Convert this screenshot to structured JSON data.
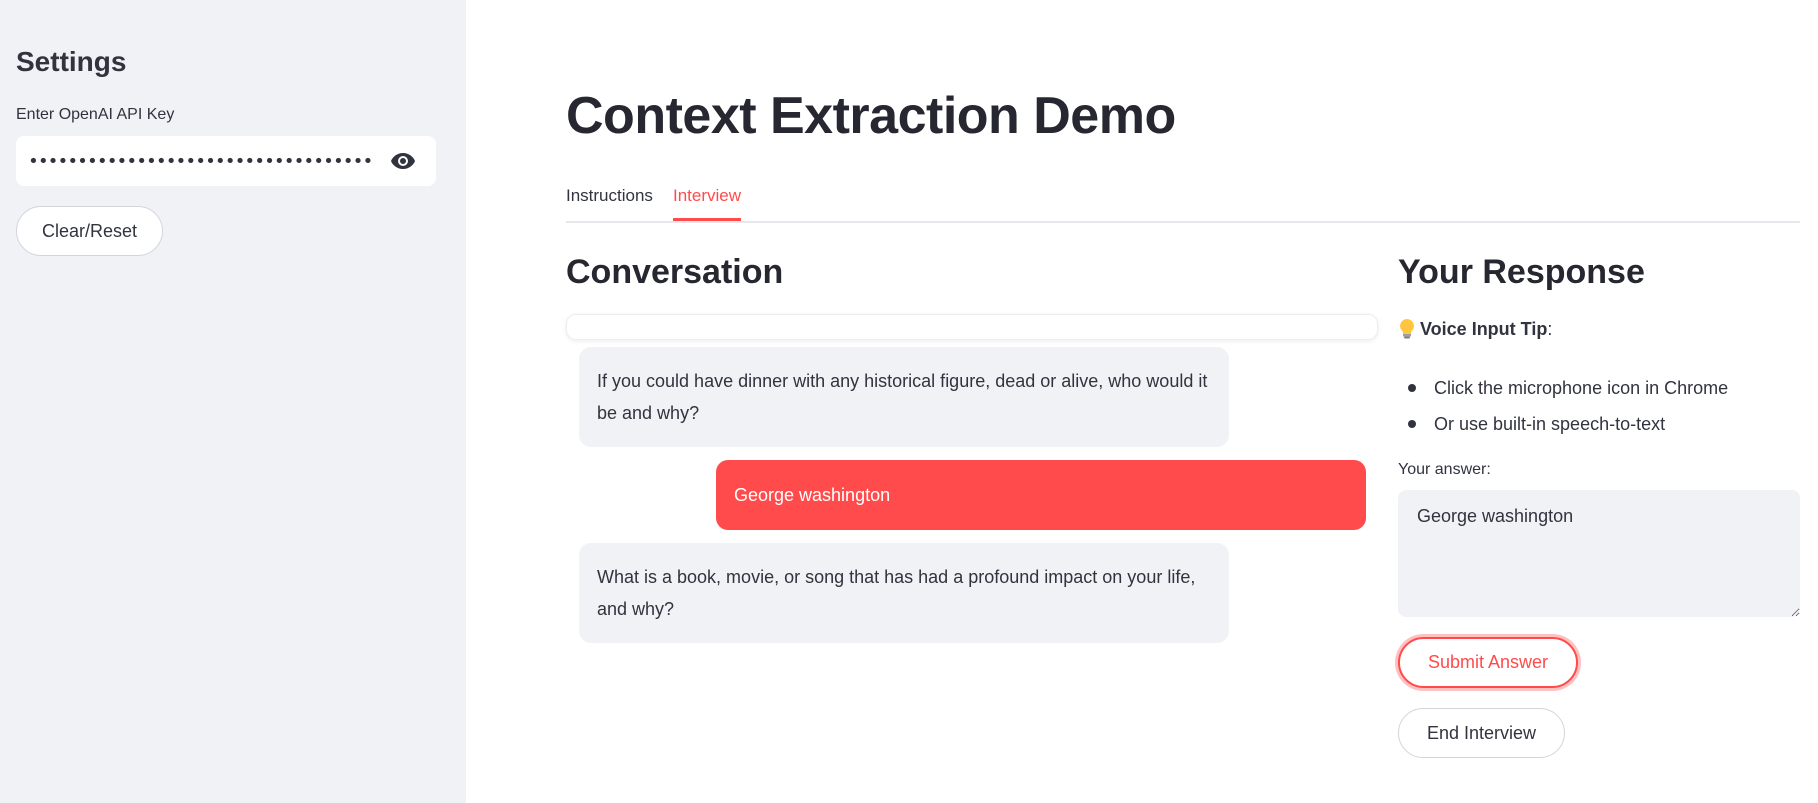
{
  "sidebar": {
    "title": "Settings",
    "api_key_label": "Enter OpenAI API Key",
    "api_key_value": "•••••••••••••••••••••••••••••••••••••••••••••••••••",
    "show_password_icon": "eye-icon",
    "clear_reset_label": "Clear/Reset"
  },
  "main": {
    "title": "Context Extraction Demo",
    "tabs": [
      {
        "label": "Instructions",
        "active": false
      },
      {
        "label": "Interview",
        "active": true
      }
    ],
    "conversation": {
      "title": "Conversation",
      "messages": [
        {
          "role": "assistant",
          "text": "If you could have dinner with any historical figure, dead or alive, who would it be and why?"
        },
        {
          "role": "user",
          "text": "George washington"
        },
        {
          "role": "assistant",
          "text": "What is a book, movie, or song that has had a profound impact on your life, and why?"
        }
      ]
    },
    "response": {
      "title": "Your Response",
      "tip_icon": "lightbulb-icon",
      "tip_heading": "Voice Input Tip",
      "tip_suffix": ":",
      "tips": [
        "Click the microphone icon in Chrome",
        "Or use built-in speech-to-text"
      ],
      "answer_label": "Your answer:",
      "answer_value": "George washington",
      "submit_label": "Submit Answer",
      "end_label": "End Interview"
    }
  },
  "colors": {
    "accent": "#ff4b4b",
    "sidebar_bg": "#f0f2f6",
    "text": "#31333f"
  }
}
